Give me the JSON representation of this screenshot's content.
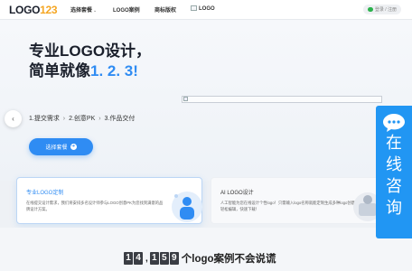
{
  "header": {
    "logo_text": "LOGO",
    "logo_num": "123",
    "nav": [
      {
        "label": "选择套餐",
        "has_dropdown": true
      },
      {
        "label": "LOGO案例"
      },
      {
        "label": "商标版权"
      },
      {
        "label": "LOGO"
      }
    ],
    "login_label": "登录 / 注册"
  },
  "hero": {
    "title_main": "专业LOGO设计，简单就像",
    "title_accent": "1. 2. 3!",
    "steps": [
      "1.提交需求",
      "2.创意PK",
      "3.作品交付"
    ],
    "cta_label": "选择套餐"
  },
  "cards": [
    {
      "title": "专业LOGO定制",
      "desc": "在线提交设计需求，我们将安排多名设计师参与LOGO创意PK为您找到满意的品牌设计方案。"
    },
    {
      "title": "AI LOGO设计",
      "desc": "人工智能为您在线设计个性logo！只需输入logo名称就能定制生成多种logo创意；轻松编辑，快速下载！"
    }
  ],
  "counter": {
    "digits_a": [
      "1",
      "4"
    ],
    "digits_b": [
      "1",
      "5",
      "9"
    ],
    "suffix": "个logo案例不会说谎"
  },
  "consult": {
    "chars": [
      "在",
      "线",
      "咨",
      "询"
    ]
  },
  "colors": {
    "accent": "#2f8cf3",
    "consult_bg": "#2196f3",
    "brand_num": "#f5a623"
  }
}
